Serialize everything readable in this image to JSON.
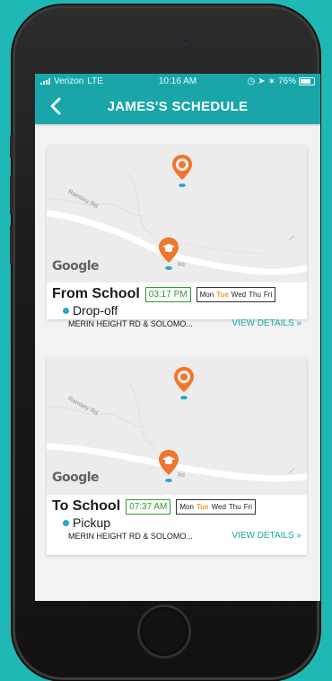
{
  "status_bar": {
    "carrier": "Verizon",
    "network": "LTE",
    "time": "10:16 AM",
    "battery": "76%"
  },
  "header": {
    "title": "JAMES'S SCHEDULE",
    "back_icon": "chevron-left-icon"
  },
  "colors": {
    "accent": "#1aa6a9",
    "time_badge": "#2e9a2e",
    "active_day": "#f39c1f",
    "pin": "#f0762e",
    "stop_dot": "#26a8c9"
  },
  "schedules": [
    {
      "direction": "From School",
      "time": "03:17 PM",
      "days": [
        "Mon",
        "Tue",
        "Wed",
        "Thu",
        "Fri"
      ],
      "active_day": "Tue",
      "stop_type": "Drop-off",
      "address": "MERIN HEIGHT RD & SOLOMO...",
      "action": "VIEW DETAILS »",
      "map": {
        "road_label": "Ramsey Rd",
        "rd_label": "Rd",
        "attribution": "Google"
      }
    },
    {
      "direction": "To School",
      "time": "07:37 AM",
      "days": [
        "Mon",
        "Tue",
        "Wed",
        "Thu",
        "Fri"
      ],
      "active_day": "Tue",
      "stop_type": "Pickup",
      "address": "MERIN HEIGHT RD & SOLOMO...",
      "action": "VIEW DETAILS »",
      "map": {
        "road_label": "Ramsey Rd",
        "rd_label": "Rd",
        "attribution": "Google"
      }
    }
  ]
}
